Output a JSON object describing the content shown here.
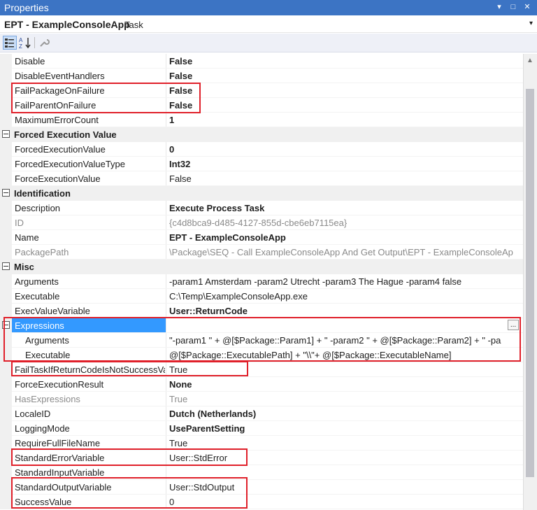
{
  "window": {
    "title": "Properties",
    "buttons": {
      "dropdown": "▾",
      "restore": "□",
      "close": "✕"
    }
  },
  "object": {
    "name": "EPT - ExampleConsoleApp",
    "type": "Task",
    "dropdown": "▾"
  },
  "toolbar": {
    "categorized": "categorized-icon",
    "alphabetical": "alphabetical-sort-icon",
    "property_pages": "wrench-icon"
  },
  "rows": [
    {
      "name": "Disable",
      "value": "False",
      "bold": true
    },
    {
      "name": "DisableEventHandlers",
      "value": "False",
      "bold": true
    },
    {
      "name": "FailPackageOnFailure",
      "value": "False",
      "bold": true
    },
    {
      "name": "FailParentOnFailure",
      "value": "False",
      "bold": true
    },
    {
      "name": "MaximumErrorCount",
      "value": "1",
      "bold": true
    },
    {
      "category": true,
      "name": "Forced Execution Value"
    },
    {
      "name": "ForcedExecutionValue",
      "value": "0",
      "bold": true
    },
    {
      "name": "ForcedExecutionValueType",
      "value": "Int32",
      "bold": true
    },
    {
      "name": "ForceExecutionValue",
      "value": "False"
    },
    {
      "category": true,
      "name": "Identification"
    },
    {
      "name": "Description",
      "value": "Execute Process Task",
      "bold": true
    },
    {
      "name": "ID",
      "value": "{c4d8bca9-d485-4127-855d-cbe6eb7115ea}",
      "gray": true
    },
    {
      "name": "Name",
      "value": "EPT - ExampleConsoleApp",
      "bold": true
    },
    {
      "name": "PackagePath",
      "value": "\\Package\\SEQ - Call ExampleConsoleApp And Get Output\\EPT - ExampleConsoleAp",
      "gray": true
    },
    {
      "category": true,
      "name": "Misc"
    },
    {
      "name": "Arguments",
      "value": "-param1 Amsterdam -param2 Utrecht -param3 The Hague -param4 false"
    },
    {
      "name": "Executable",
      "value": "C:\\Temp\\ExampleConsoleApp.exe"
    },
    {
      "name": "ExecValueVariable",
      "value": "User::ReturnCode",
      "bold": true
    },
    {
      "name": "Expressions",
      "value": "",
      "selected": true,
      "expander": true,
      "ellipsis": "..."
    },
    {
      "name": "Arguments",
      "value": "\"-param1 \" +  @[$Package::Param1]  + \" -param2 \" +  @[$Package::Param2] + \" -pa",
      "sub": true
    },
    {
      "name": "Executable",
      "value": "@[$Package::ExecutablePath] + \"\\\\\"+ @[$Package::ExecutableName]",
      "sub": true
    },
    {
      "name": "FailTaskIfReturnCodeIsNotSuccessValue",
      "value": "True"
    },
    {
      "name": "ForceExecutionResult",
      "value": "None",
      "bold": true
    },
    {
      "name": "HasExpressions",
      "value": "True",
      "gray": true
    },
    {
      "name": "LocaleID",
      "value": "Dutch (Netherlands)",
      "bold": true
    },
    {
      "name": "LoggingMode",
      "value": "UseParentSetting",
      "bold": true
    },
    {
      "name": "RequireFullFileName",
      "value": "True"
    },
    {
      "name": "StandardErrorVariable",
      "value": "User::StdError"
    },
    {
      "name": "StandardInputVariable",
      "value": ""
    },
    {
      "name": "StandardOutputVariable",
      "value": "User::StdOutput"
    },
    {
      "name": "SuccessValue",
      "value": "0"
    }
  ],
  "colors": {
    "titlebar": "#3c74c4",
    "selection": "#3399ff",
    "highlight": "#e0202a"
  }
}
